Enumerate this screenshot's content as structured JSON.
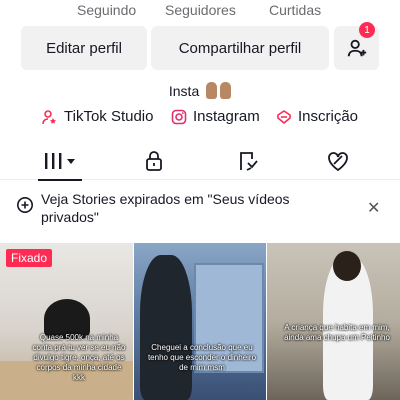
{
  "profile": {
    "stats": [
      {
        "label": "Seguindo"
      },
      {
        "label": "Seguidores"
      },
      {
        "label": "Curtidas"
      }
    ],
    "buttons": {
      "edit": "Editar perfil",
      "share": "Compartilhar perfil",
      "add_friends_badge": "1"
    },
    "bio": "Insta",
    "links": [
      {
        "label": "TikTok Studio",
        "icon": "tiktok-studio-icon"
      },
      {
        "label": "Instagram",
        "icon": "instagram-icon"
      },
      {
        "label": "Inscrição",
        "icon": "subscription-icon"
      }
    ]
  },
  "tabs": [
    {
      "icon": "videos-grid-icon",
      "active": true
    },
    {
      "icon": "lock-icon",
      "active": false
    },
    {
      "icon": "reposts-icon",
      "active": false
    },
    {
      "icon": "liked-heart-icon",
      "active": false
    }
  ],
  "notice": {
    "text": "Veja Stories expirados em \"Seus vídeos privados\"",
    "icon": "info-plus-icon"
  },
  "videos": [
    {
      "pinned_label": "Fixado",
      "caption": "Quase 500k na minha conta prá tu ver se eu não divulgo tigre, onça, até os corpos da minha cidade kkk"
    },
    {
      "caption": "Cheguei a conclusão que eu tenho que esconder o dinheiro de mim msm"
    },
    {
      "caption": "A criança que habita em mim, ainda ama chupa um Peitinho"
    }
  ],
  "colors": {
    "accent": "#fe2c55",
    "button_bg": "#f1f1f2",
    "text_primary": "#161823",
    "text_secondary": "#6b6b70"
  }
}
